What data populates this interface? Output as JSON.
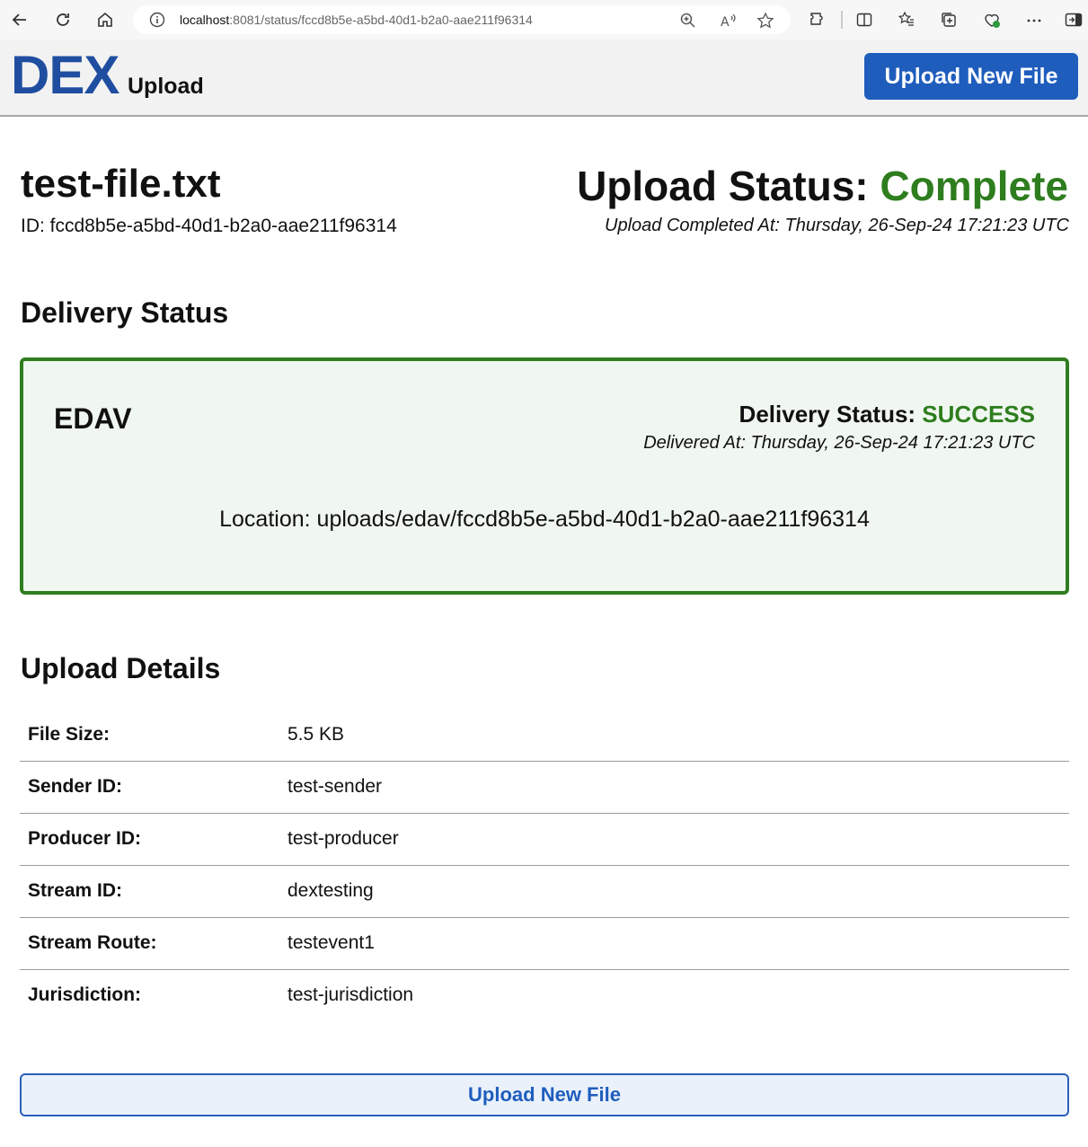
{
  "browser": {
    "url_host": "localhost",
    "url_path": ":8081/status/fccd8b5e-a5bd-40d1-b2a0-aae211f96314"
  },
  "header": {
    "logo": "DEX",
    "logo_sub": "Upload",
    "upload_button": "Upload New File"
  },
  "file": {
    "name": "test-file.txt",
    "id_line": "ID: fccd8b5e-a5bd-40d1-b2a0-aae211f96314",
    "status_label": "Upload Status: ",
    "status_value": "Complete",
    "completed_at": "Upload Completed At: Thursday, 26-Sep-24 17:21:23 UTC"
  },
  "delivery": {
    "section_title": "Delivery Status",
    "destination": "EDAV",
    "status_label": "Delivery Status: ",
    "status_value": "SUCCESS",
    "delivered_at": "Delivered At: Thursday, 26-Sep-24 17:21:23 UTC",
    "location": "Location: uploads/edav/fccd8b5e-a5bd-40d1-b2a0-aae211f96314"
  },
  "details": {
    "section_title": "Upload Details",
    "rows": [
      {
        "label": "File Size:",
        "value": "5.5 KB"
      },
      {
        "label": "Sender ID:",
        "value": "test-sender"
      },
      {
        "label": "Producer ID:",
        "value": "test-producer"
      },
      {
        "label": "Stream ID:",
        "value": "dextesting"
      },
      {
        "label": "Stream Route:",
        "value": "testevent1"
      },
      {
        "label": "Jurisdiction:",
        "value": "test-jurisdiction"
      }
    ]
  },
  "footer": {
    "upload_button": "Upload New File"
  },
  "colors": {
    "brand_blue": "#1f4ea1",
    "success_green": "#2e7d1e"
  }
}
